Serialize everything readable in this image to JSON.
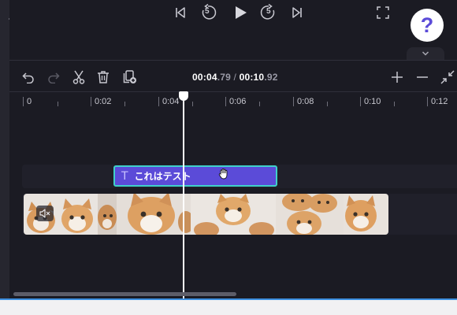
{
  "playback": {
    "icons": [
      "skip-back-icon",
      "rewind-5-icon",
      "play-icon",
      "forward-5-icon",
      "skip-forward-icon",
      "fullscreen-icon"
    ],
    "rewind_label": "5",
    "forward_label": "5"
  },
  "help": {
    "label": "?"
  },
  "toolbar": {
    "icons": [
      "undo-icon",
      "redo-icon",
      "cut-icon",
      "delete-icon",
      "duplicate-icon",
      "zoom-in-icon",
      "zoom-out-icon",
      "fit-icon"
    ]
  },
  "timecode": {
    "current_main": "00:04",
    "current_frac": ".79",
    "separator": " / ",
    "total_main": "00:10",
    "total_frac": ".92"
  },
  "ruler": {
    "labels": [
      "0",
      "0:02",
      "0:04",
      "0:06",
      "0:08",
      "0:10",
      "0:12"
    ]
  },
  "text_clip": {
    "icon": "T",
    "label": "これはテスト"
  },
  "video_clip": {
    "muted": true,
    "thumbnails": "kitten-frames"
  },
  "colors": {
    "background": "#1b1b23",
    "accent": "#5b4bd8",
    "selection": "#3fd0c9",
    "playhead": "#ffffff",
    "focus_line": "#3d8fe0"
  }
}
